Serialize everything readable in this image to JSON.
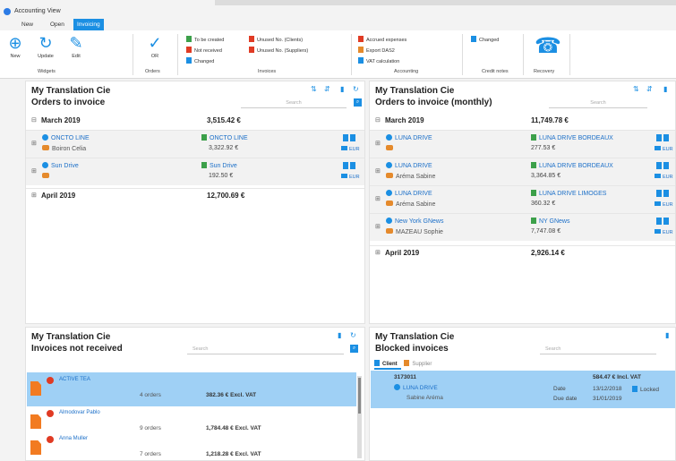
{
  "window": {
    "title": "Accounting View"
  },
  "tabs": [
    {
      "label": "New",
      "active": false
    },
    {
      "label": "Open",
      "active": false
    },
    {
      "label": "Invoicing",
      "active": true
    }
  ],
  "ribbon": {
    "widgets": {
      "label": "Widgets",
      "buttons": [
        {
          "label": "New",
          "icon": "plus-circle-icon"
        },
        {
          "label": "Update",
          "icon": "refresh-icon"
        },
        {
          "label": "Edit",
          "icon": "pencil-icon"
        }
      ]
    },
    "orders": {
      "label": "Orders",
      "button": {
        "label": "OR",
        "icon": "check-circle-icon"
      }
    },
    "invoices": {
      "label": "Invoices",
      "items": [
        {
          "label": "To be created",
          "color": "#3ca04a"
        },
        {
          "label": "Not received",
          "color": "#e03b24"
        },
        {
          "label": "Changed",
          "color": "#1b8fe3"
        },
        {
          "label": "Unused No. (Clients)",
          "color": "#e03b24"
        },
        {
          "label": "Unused No. (Suppliers)",
          "color": "#e03b24"
        }
      ]
    },
    "accounting": {
      "label": "Accounting",
      "items": [
        {
          "label": "Accrued expenses",
          "color": "#e03b24"
        },
        {
          "label": "Export DAS2",
          "color": "#e58a2c"
        },
        {
          "label": "VAT calculation",
          "color": "#1b8fe3"
        }
      ]
    },
    "credit_notes": {
      "label": "Credit notes",
      "item": {
        "label": "Changed",
        "color": "#1b8fe3"
      }
    },
    "recovery": {
      "label": "Recovery",
      "icon": "phone-icon"
    }
  },
  "panels": {
    "orders_to_invoice": {
      "company": "My Translation Cie",
      "title": "Orders to invoice",
      "search_placeholder": "Search",
      "groups": [
        {
          "month": "March 2019",
          "amount": "3,515.42 €",
          "expanded": true,
          "rows": [
            {
              "client": "ONCTO LINE",
              "contact": "Boiron Celia",
              "company": "ONCTO LINE",
              "amount": "3,322.92 €",
              "currency": "EUR"
            },
            {
              "client": "Sun Drive",
              "contact": "",
              "company": "Sun Drive",
              "amount": "192.50 €",
              "currency": "EUR"
            }
          ]
        },
        {
          "month": "April 2019",
          "amount": "12,700.69 €",
          "expanded": false,
          "rows": []
        }
      ]
    },
    "orders_to_invoice_monthly": {
      "company": "My Translation Cie",
      "title": "Orders to invoice (monthly)",
      "search_placeholder": "Search",
      "groups": [
        {
          "month": "March 2019",
          "amount": "11,749.78 €",
          "expanded": true,
          "rows": [
            {
              "client": "LUNA DRIVE",
              "contact": "",
              "company": "LUNA DRIVE BORDEAUX",
              "amount": "277.53 €",
              "currency": "EUR"
            },
            {
              "client": "LUNA DRIVE",
              "contact": "Aréma Sabine",
              "company": "LUNA DRIVE BORDEAUX",
              "amount": "3,364.85 €",
              "currency": "EUR"
            },
            {
              "client": "LUNA DRIVE",
              "contact": "Aréma Sabine",
              "company": "LUNA DRIVE LIMOGES",
              "amount": "360.32 €",
              "currency": "EUR"
            },
            {
              "client": "New York GNews",
              "contact": "MAZEAU Sophie",
              "company": "NY GNews",
              "amount": "7,747.08 €",
              "currency": "EUR"
            }
          ]
        },
        {
          "month": "April 2019",
          "amount": "2,926.14 €",
          "expanded": false,
          "rows": []
        }
      ]
    },
    "invoices_not_received": {
      "company": "My Translation Cie",
      "title": "Invoices not received",
      "search_placeholder": "Search",
      "rows": [
        {
          "name": "ACTIVE TEA",
          "orders": "4 orders",
          "amount": "382.36 € Excl. VAT",
          "selected": true
        },
        {
          "name": "Almodovar Pablo",
          "orders": "9 orders",
          "amount": "1,784.48 € Excl. VAT",
          "selected": false
        },
        {
          "name": "Anna Muller",
          "orders": "7 orders",
          "amount": "1,218.28 € Excl. VAT",
          "selected": false
        }
      ]
    },
    "blocked_invoices": {
      "company": "My Translation Cie",
      "title": "Blocked invoices",
      "search_placeholder": "Search",
      "tabs": [
        {
          "label": "Client"
        },
        {
          "label": "Supplier"
        }
      ],
      "row": {
        "number": "3173011",
        "client": "LUNA DRIVE",
        "contact": "Sabine Aréma",
        "amount": "584.47 € Incl. VAT",
        "date_label": "Date",
        "date": "13/12/2018",
        "status": "Locked",
        "due_label": "Due date",
        "due_date": "31/01/2019"
      }
    }
  }
}
